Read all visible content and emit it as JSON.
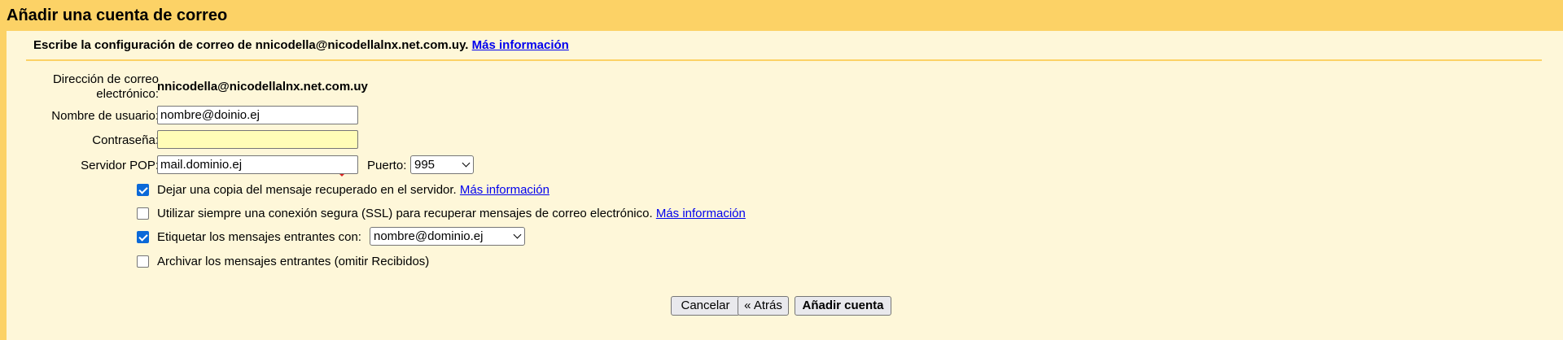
{
  "window": {
    "title": "Añadir una cuenta de correo"
  },
  "header": {
    "intro": "Escribe la configuración de correo de nnicodella@nicodellalnx.net.com.uy.",
    "more_info": "Más información"
  },
  "form": {
    "email": {
      "label": "Dirección de correo electrónico:",
      "value": "nnicodella@nicodellalnx.net.com.uy"
    },
    "username": {
      "label": "Nombre de usuario:",
      "value": "nombre@doinio.ej"
    },
    "password": {
      "label": "Contraseña:",
      "mask": "••••••••••",
      "icon": "password-manager-icon"
    },
    "pop_server": {
      "label": "Servidor POP:",
      "value": "mail.dominio.ej"
    },
    "port": {
      "label": "Puerto:",
      "value": "995"
    }
  },
  "options": [
    {
      "label": "Dejar una copia del mensaje recuperado en el servidor.",
      "checked": true,
      "link": "Más información"
    },
    {
      "label": "Utilizar siempre una conexión segura (SSL) para recuperar mensajes de correo electrónico.",
      "checked": false,
      "link": "Más información"
    },
    {
      "label": "Etiquetar los mensajes entrantes con:",
      "checked": true,
      "select_value": "nombre@dominio.ej"
    },
    {
      "label": "Archivar los mensajes entrantes (omitir Recibidos)",
      "checked": false
    }
  ],
  "buttons": {
    "cancel": "Cancelar",
    "back": "« Atrás",
    "add_account": "Añadir cuenta"
  },
  "colors": {
    "header": "#fcd266",
    "panel": "#fef7d9",
    "link": "#0000ee",
    "checkbox_checked": "#0b69d8",
    "password_icon": "#d92323"
  }
}
